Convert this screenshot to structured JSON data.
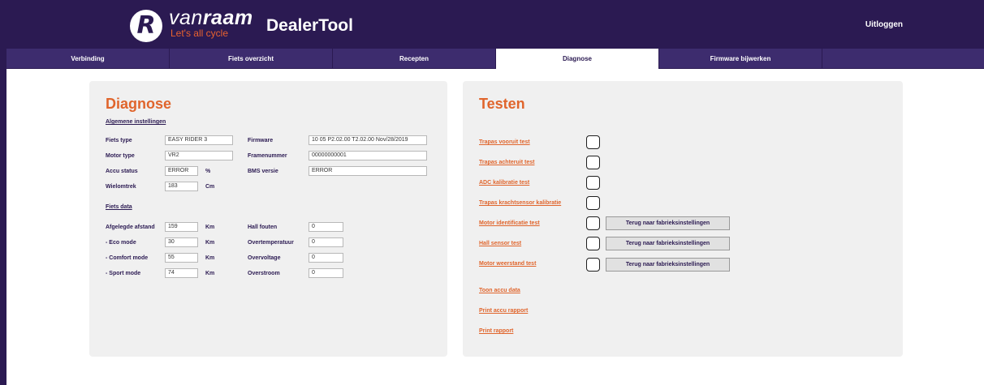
{
  "header": {
    "brand_prefix": "van",
    "brand_suffix": "raam",
    "brand_slogan": "Let's all cycle",
    "app_title": "DealerTool",
    "logout_label": "Uitloggen"
  },
  "nav": {
    "tabs": [
      {
        "label": "Verbinding"
      },
      {
        "label": "Fiets overzicht"
      },
      {
        "label": "Recepten"
      },
      {
        "label": "Diagnose"
      },
      {
        "label": "Firmware bijwerken"
      }
    ],
    "active": "Diagnose"
  },
  "diagnose": {
    "title": "Diagnose",
    "general_heading": "Algemene instellingen",
    "general": {
      "bike_type_label": "Fiets type",
      "bike_type_value": "EASY RIDER 3",
      "motor_type_label": "Motor type",
      "motor_type_value": "VR2",
      "battery_status_label": "Accu status",
      "battery_status_value": "ERROR",
      "battery_status_unit": "%",
      "wheel_circumference_label": "Wielomtrek",
      "wheel_circumference_value": "183",
      "wheel_circumference_unit": "Cm",
      "firmware_label": "Firmware",
      "firmware_value": "10 05 P2.02.00 T2.02.00 Nov/28/2019",
      "frame_number_label": "Framenummer",
      "frame_number_value": "00000000001",
      "bms_version_label": "BMS versie",
      "bms_version_value": "ERROR"
    },
    "bike_data_heading": "Fiets data",
    "bike_data": {
      "distance_label": "Afgelegde afstand",
      "distance_value": "159",
      "distance_unit": "Km",
      "eco_label": "- Eco mode",
      "eco_value": "30",
      "eco_unit": "Km",
      "comfort_label": "- Comfort mode",
      "comfort_value": "55",
      "comfort_unit": "Km",
      "sport_label": "- Sport mode",
      "sport_value": "74",
      "sport_unit": "Km",
      "hall_errors_label": "Hall fouten",
      "hall_errors_value": "0",
      "overtemp_label": "Overtemperatuur",
      "overtemp_value": "0",
      "overvoltage_label": "Overvoltage",
      "overvoltage_value": "0",
      "overcurrent_label": "Overstroom",
      "overcurrent_value": "0"
    }
  },
  "tests": {
    "title": "Testen",
    "items": [
      {
        "label": "Trapas vooruit test"
      },
      {
        "label": "Trapas achteruit test"
      },
      {
        "label": "ADC kalibratie test"
      },
      {
        "label": "Trapas krachtsensor kalibratie"
      },
      {
        "label": "Motor identificatie test",
        "reset_label": "Terug naar fabrieksinstellingen"
      },
      {
        "label": "Hall sensor test",
        "reset_label": "Terug naar fabrieksinstellingen"
      },
      {
        "label": "Motor weerstand test",
        "reset_label": "Terug naar fabrieksinstellingen"
      }
    ],
    "links": [
      {
        "label": "Toon accu data"
      },
      {
        "label": "Print accu rapport"
      },
      {
        "label": "Print rapport"
      }
    ]
  },
  "colors": {
    "header_bg": "#2b1a52",
    "nav_bg": "#3d2c6e",
    "accent": "#e0652c",
    "panel_bg": "#f0f0f0"
  }
}
